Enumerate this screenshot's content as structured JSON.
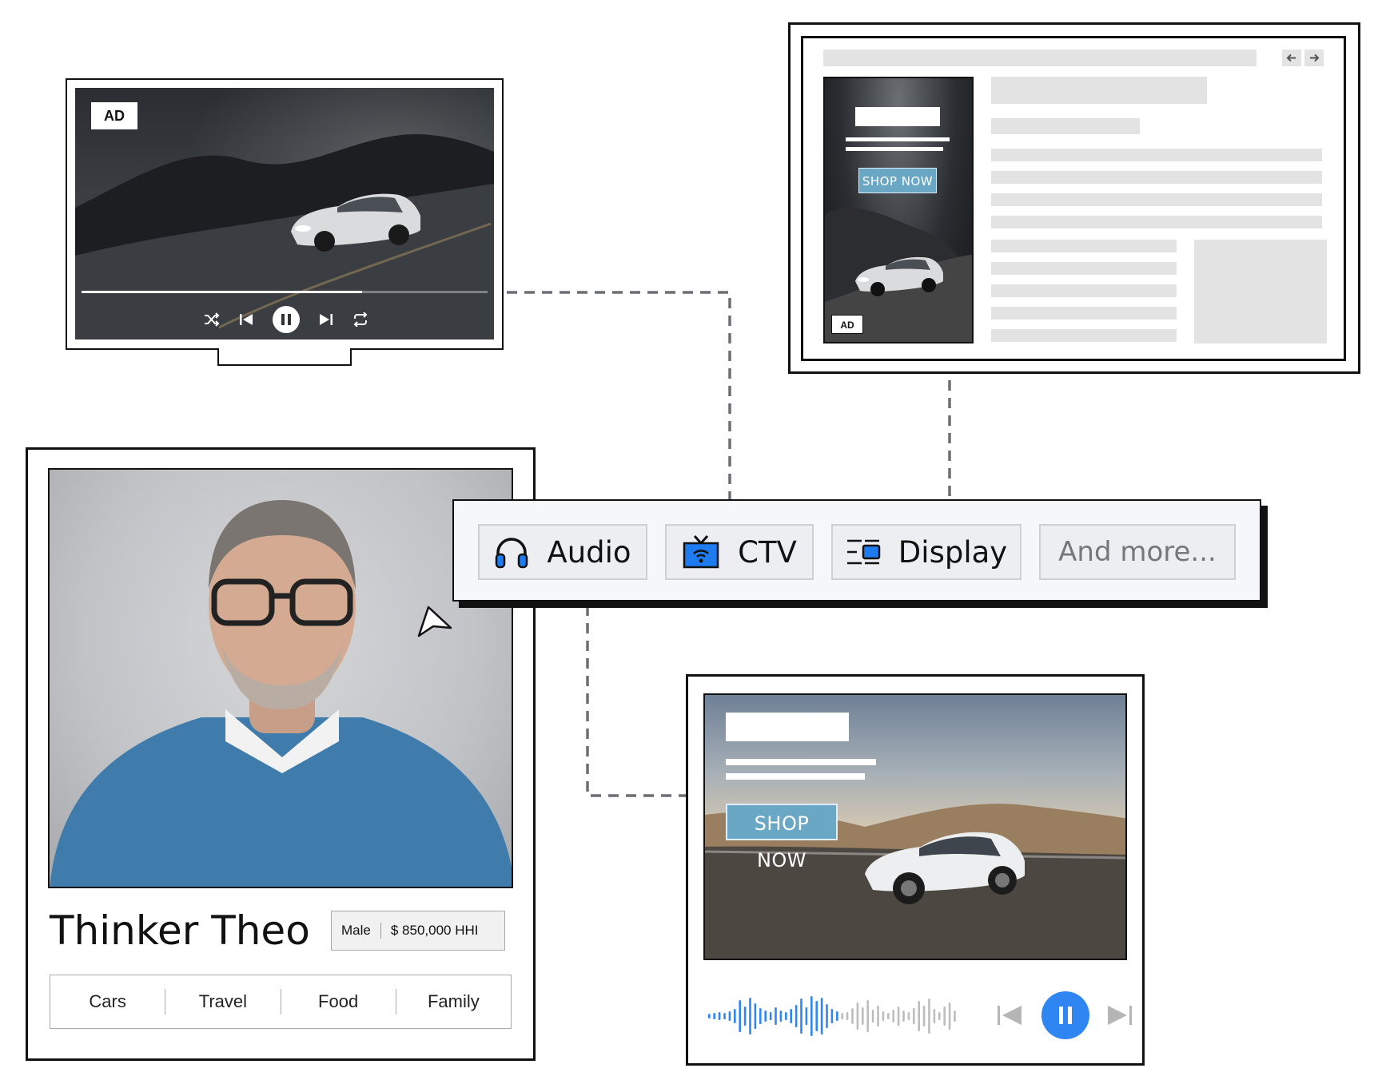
{
  "tv": {
    "ad_badge": "AD",
    "progress": 0.69,
    "controls": [
      "shuffle-icon",
      "previous-icon",
      "pause-icon",
      "next-icon",
      "repeat-icon"
    ]
  },
  "browser": {
    "ad_badge": "AD",
    "shop_now": "SHOP NOW",
    "nav": [
      "arrow-left-icon",
      "arrow-right-icon"
    ]
  },
  "profile": {
    "name": "Thinker Theo",
    "gender": "Male",
    "income": "$ 850,000 HHI",
    "interests": [
      "Cars",
      "Travel",
      "Food",
      "Family"
    ]
  },
  "channels": {
    "items": [
      {
        "label": "Audio",
        "icon": "headphones-icon"
      },
      {
        "label": "CTV",
        "icon": "tv-icon"
      },
      {
        "label": "Display",
        "icon": "display-icon"
      },
      {
        "label": "And more..."
      }
    ],
    "accent": "#1e7bf0"
  },
  "audio_ad": {
    "shop_now": "SHOP NOW",
    "accent": "#2f86f2",
    "played_fraction": 0.54
  }
}
